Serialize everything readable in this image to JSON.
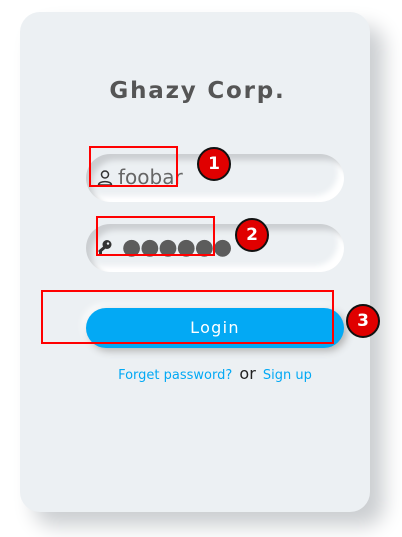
{
  "login": {
    "brand": "Ghazy Corp.",
    "username_value": "foobar",
    "password_value": "●●●●●●",
    "button_label": "Login",
    "forget_password_label": "Forget password?",
    "or_label": "or",
    "signup_label": "Sign up"
  },
  "icons": {
    "user_icon": "user-icon",
    "password_icon": "key-icon"
  },
  "annotations": {
    "marker_1": "1",
    "marker_2": "2",
    "marker_3": "3"
  },
  "colors": {
    "card_bg": "#ecf0f3",
    "accent": "#03a9f4",
    "annotation": "#ff0000"
  }
}
